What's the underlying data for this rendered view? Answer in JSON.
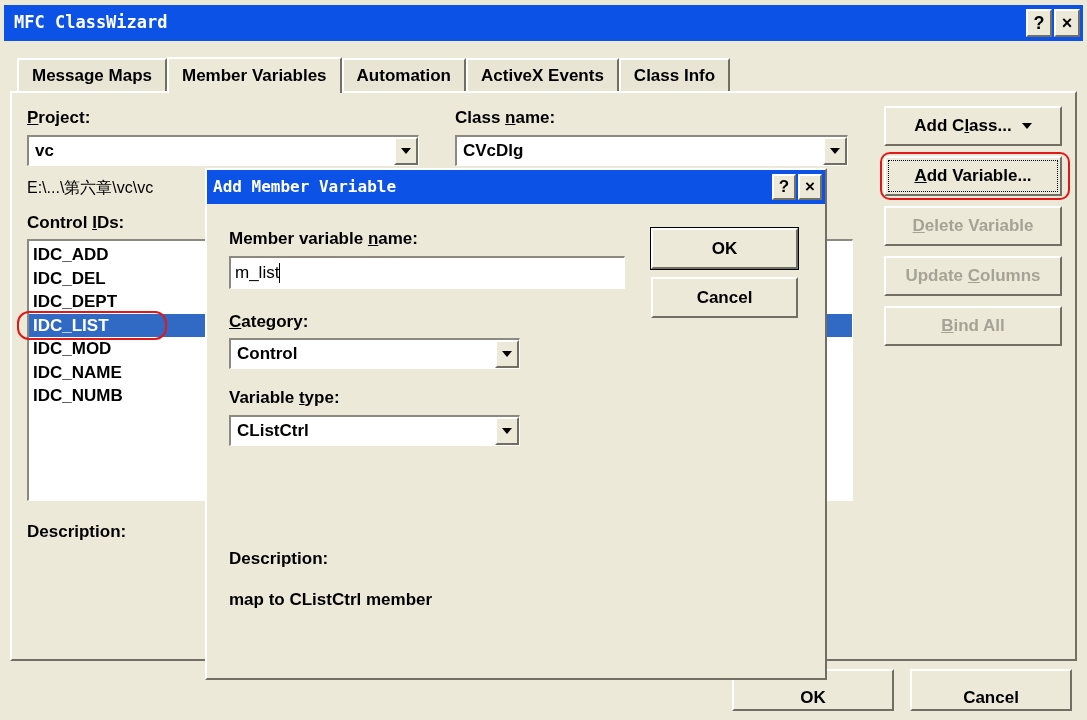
{
  "window": {
    "title": "MFC ClassWizard",
    "buttons": [
      "?",
      "×"
    ]
  },
  "tabs": [
    {
      "label": "Message Maps",
      "selected": false
    },
    {
      "label": "Member Variables",
      "selected": true
    },
    {
      "label": "Automation",
      "selected": false
    },
    {
      "label": "ActiveX Events",
      "selected": false
    },
    {
      "label": "Class Info",
      "selected": false
    }
  ],
  "project": {
    "label": {
      "key": "P",
      "post": "roject:"
    },
    "value": "vc"
  },
  "class_name": {
    "label": {
      "pre": "Class ",
      "key": "n",
      "post": "ame:"
    },
    "value": "CVcDlg"
  },
  "file_path": "E:\\...\\第六章\\vc\\vc",
  "control_ids": {
    "label": {
      "pre": "Control ",
      "key": "I",
      "post": "Ds:"
    },
    "items": [
      {
        "text": "IDC_ADD",
        "selected": false,
        "circled": false
      },
      {
        "text": "IDC_DEL",
        "selected": false,
        "circled": false
      },
      {
        "text": "IDC_DEPT",
        "selected": false,
        "circled": false
      },
      {
        "text": "IDC_LIST",
        "selected": true,
        "circled": true
      },
      {
        "text": "IDC_MOD",
        "selected": false,
        "circled": false
      },
      {
        "text": "IDC_NAME",
        "selected": false,
        "circled": false
      },
      {
        "text": "IDC_NUMB",
        "selected": false,
        "circled": false
      }
    ]
  },
  "description_label": "Description:",
  "side_buttons": [
    {
      "label": {
        "pre": "Add C",
        "key": "l",
        "post": "ass..."
      },
      "dropdown": true,
      "disabled": false,
      "focused": false,
      "circled": false
    },
    {
      "label": {
        "key": "A",
        "post": "dd Variable..."
      },
      "dropdown": false,
      "disabled": false,
      "focused": true,
      "circled": true
    },
    {
      "label": {
        "key": "D",
        "post": "elete Variable"
      },
      "dropdown": false,
      "disabled": true,
      "focused": false,
      "circled": false
    },
    {
      "label": {
        "pre": "Update ",
        "key": "C",
        "post": "olumns"
      },
      "dropdown": false,
      "disabled": true,
      "focused": false,
      "circled": false
    },
    {
      "label": {
        "key": "B",
        "post": "ind All"
      },
      "dropdown": false,
      "disabled": true,
      "focused": false,
      "circled": false
    }
  ],
  "footer_buttons": [
    "OK",
    "Cancel"
  ],
  "dialog": {
    "title": "Add Member Variable",
    "title_buttons": [
      "?",
      "×"
    ],
    "name": {
      "label": {
        "pre": "Member variable ",
        "key": "n",
        "post": "ame:"
      },
      "value": "m_list"
    },
    "category": {
      "label": {
        "key": "C",
        "post": "ategory:"
      },
      "value": "Control"
    },
    "variable_type": {
      "label": {
        "pre": "Variable ",
        "key": "t",
        "post": "ype:"
      },
      "value": "CListCtrl"
    },
    "buttons": [
      "OK",
      "Cancel"
    ],
    "description_label": "Description:",
    "description": "map to CListCtrl member"
  }
}
